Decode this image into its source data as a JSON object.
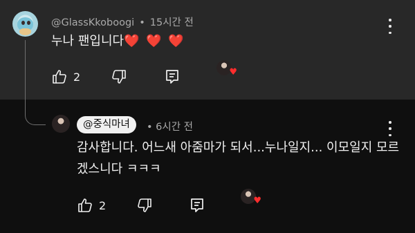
{
  "comment": {
    "author": "@GlassKkoboogi",
    "separator": "•",
    "time": "15시간 전",
    "text": "누나 팬입니다",
    "hearts": "❤️ ❤️ ❤️",
    "like_count": "2",
    "icons": {
      "like": "thumbs-up-icon",
      "dislike": "thumbs-down-icon",
      "reply": "reply-icon",
      "more": "more-vert-icon",
      "creator_heart": "creator-heart-icon"
    }
  },
  "reply": {
    "author": "@중식마녀",
    "separator": "•",
    "time": "6시간 전",
    "text": "감사합니다. 어느새 아줌마가 되서...누나일지... 이모일지 모르겠스니다 ㅋㅋㅋ",
    "like_count": "2"
  },
  "colors": {
    "top_background": "#282828",
    "reply_background": "#0f0f0f",
    "text": "#f1f1f1",
    "meta": "#aaaaaa",
    "heart": "#e0332e"
  }
}
